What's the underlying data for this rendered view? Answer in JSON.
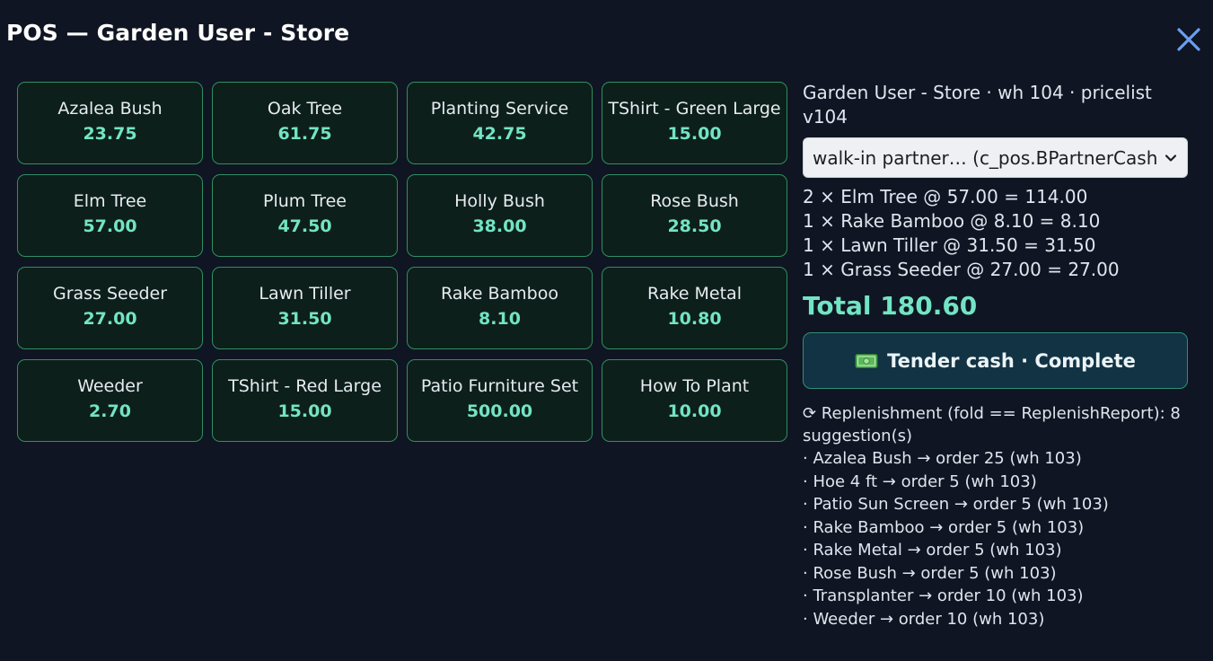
{
  "header": {
    "title": "POS — Garden User - Store"
  },
  "products": [
    {
      "name": "Azalea Bush",
      "price": "23.75"
    },
    {
      "name": "Oak Tree",
      "price": "61.75"
    },
    {
      "name": "Planting Service",
      "price": "42.75"
    },
    {
      "name": "TShirt - Green Large",
      "price": "15.00"
    },
    {
      "name": "Elm Tree",
      "price": "57.00"
    },
    {
      "name": "Plum Tree",
      "price": "47.50"
    },
    {
      "name": "Holly Bush",
      "price": "38.00"
    },
    {
      "name": "Rose Bush",
      "price": "28.50"
    },
    {
      "name": "Grass Seeder",
      "price": "27.00"
    },
    {
      "name": "Lawn Tiller",
      "price": "31.50"
    },
    {
      "name": "Rake Bamboo",
      "price": "8.10"
    },
    {
      "name": "Rake Metal",
      "price": "10.80"
    },
    {
      "name": "Weeder",
      "price": "2.70"
    },
    {
      "name": "TShirt - Red Large",
      "price": "15.00"
    },
    {
      "name": "Patio Furniture Set",
      "price": "500.00"
    },
    {
      "name": "How To Plant",
      "price": "10.00"
    }
  ],
  "side": {
    "store_info": "Garden User - Store · wh 104 · pricelist v104",
    "partner_selected": "walk-in partner… (c_pos.BPartnerCash)",
    "cart_lines": [
      "2 × Elm Tree @ 57.00 = 114.00",
      "1 × Rake Bamboo @ 8.10 = 8.10",
      "1 × Lawn Tiller @ 31.50 = 31.50",
      "1 × Grass Seeder @ 27.00 = 27.00"
    ],
    "total": "Total 180.60",
    "tender_label": "Tender cash · Complete",
    "replenishment": {
      "heading": "⟳ Replenishment (fold == ReplenishReport): 8 suggestion(s)",
      "items": [
        "· Azalea Bush → order 25 (wh 103)",
        "· Hoe 4 ft → order 5 (wh 103)",
        "· Patio Sun Screen → order 5 (wh 103)",
        "· Rake Bamboo → order 5 (wh 103)",
        "· Rake Metal → order 5 (wh 103)",
        "· Rose Bush → order 5 (wh 103)",
        "· Transplanter → order 10 (wh 103)",
        "· Weeder → order 10 (wh 103)"
      ]
    }
  },
  "icons": {
    "close": "close-icon",
    "chevron": "chevron-down-icon",
    "cash": "cash-icon"
  },
  "colors": {
    "background": "#0f1522",
    "accent": "#72e4c4",
    "tile_border": "#2f8f60",
    "tile_bg": "#0d1f1a",
    "close_icon": "#6a9ff0",
    "button_bg": "#123343"
  }
}
